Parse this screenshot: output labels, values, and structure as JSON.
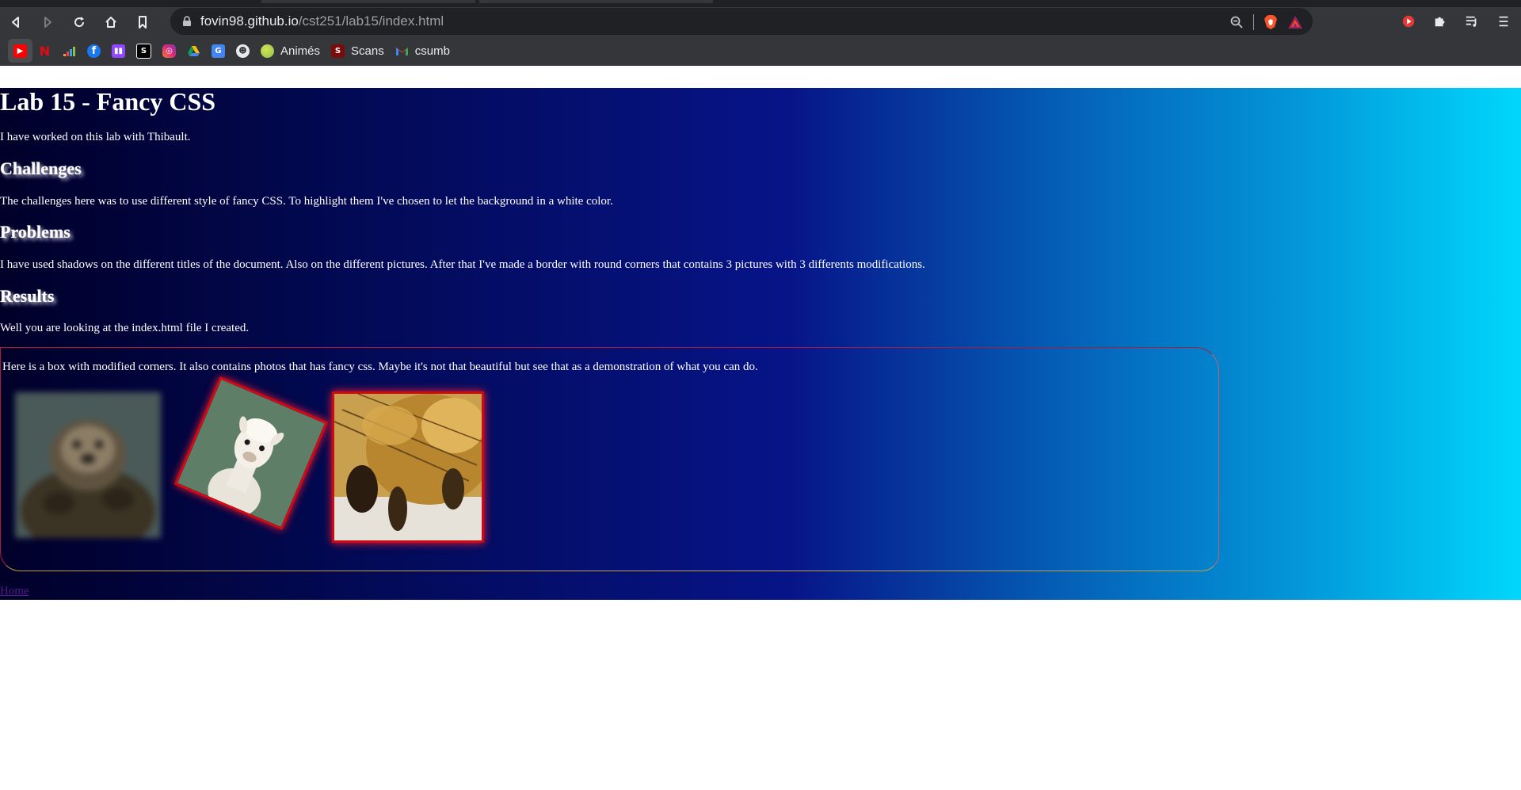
{
  "browser": {
    "url_domain": "fovin98.github.io",
    "url_path": "/cst251/lab15/index.html",
    "bookmarks": [
      {
        "icon": "youtube-icon",
        "label": ""
      },
      {
        "icon": "netflix-icon",
        "label": ""
      },
      {
        "icon": "deezer-icon",
        "label": ""
      },
      {
        "icon": "facebook-icon",
        "label": ""
      },
      {
        "icon": "twitch-icon",
        "label": ""
      },
      {
        "icon": "bookmark-app-icon",
        "label": ""
      },
      {
        "icon": "instagram-icon",
        "label": ""
      },
      {
        "icon": "google-drive-icon",
        "label": ""
      },
      {
        "icon": "google-translate-icon",
        "label": ""
      },
      {
        "icon": "anime-site-icon",
        "label": ""
      },
      {
        "icon": "animes-folder-icon",
        "label": "Animés"
      },
      {
        "icon": "scans-folder-icon",
        "label": "Scans"
      },
      {
        "icon": "gmail-icon",
        "label": "csumb"
      }
    ],
    "colors": {
      "toolbar": "#35363a",
      "omnibox": "#202124",
      "text": "#e8eaed"
    }
  },
  "page": {
    "title": "Lab 15 - Fancy CSS",
    "intro": "I have worked on this lab with Thibault.",
    "sections": [
      {
        "heading": "Challenges",
        "text": "The challenges here was to use different style of fancy CSS. To highlight them I've chosen to let the background in a white color."
      },
      {
        "heading": "Problems",
        "text": "I have used shadows on the different titles of the document. Also on the different pictures. After that I've made a border with round corners that contains 3 pictures with 3 differents modifications."
      },
      {
        "heading": "Results",
        "text": "Well you are looking at the index.html file I created."
      }
    ],
    "box_text": "Here is a box with modified corners. It also contains photos that has fancy css. Maybe it's not that beautiful but see that as a demonstration of what you can do.",
    "photos": [
      {
        "subject": "otter",
        "effect": "blur"
      },
      {
        "subject": "alpaca",
        "effect": "rotate"
      },
      {
        "subject": "bee",
        "effect": "shadow"
      }
    ],
    "home_link": "Home",
    "colors": {
      "gradient_start": "#000029",
      "gradient_mid": "#071488",
      "gradient_end": "#00d7fc",
      "shadow_red": "#ff1a2a",
      "link": "#551a8b"
    }
  }
}
